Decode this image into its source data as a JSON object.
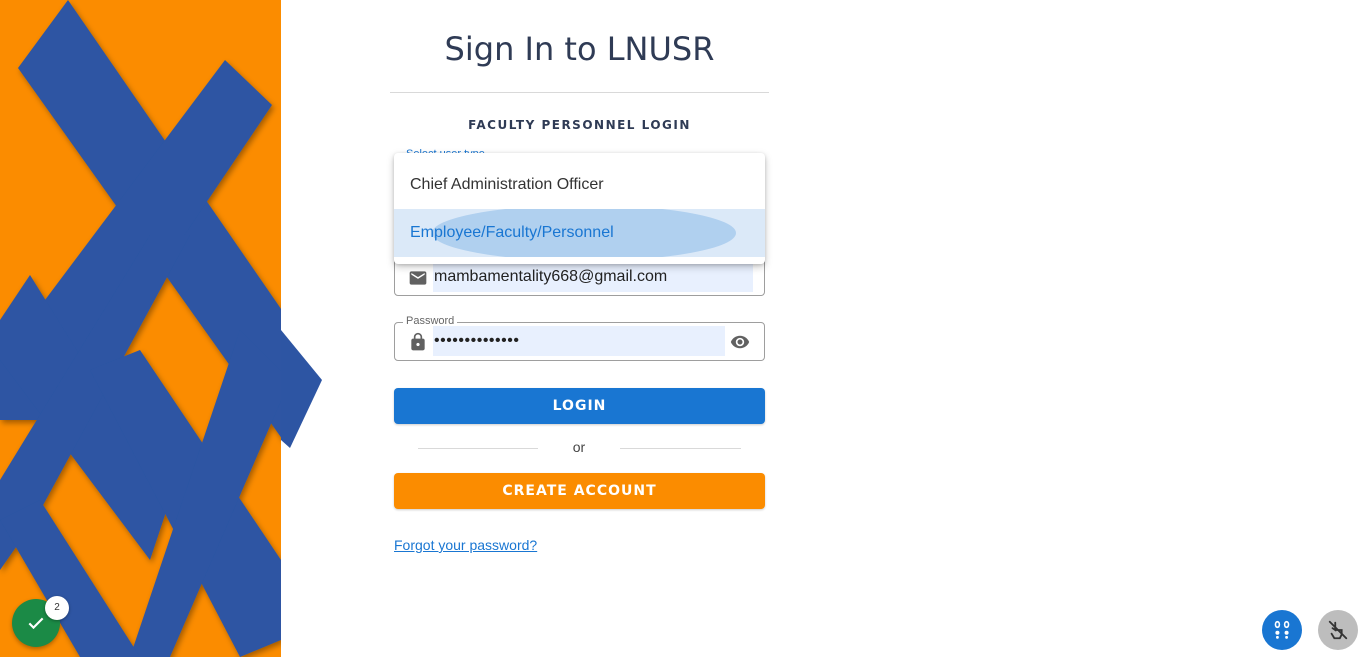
{
  "page": {
    "title": "Sign In to LNUSR",
    "subtitle": "FACULTY PERSONNEL LOGIN"
  },
  "user_type_select": {
    "label": "Select user type",
    "options": [
      {
        "label": "Chief Administration Officer",
        "highlighted": false
      },
      {
        "label": "Employee/Faculty/Personnel",
        "highlighted": true
      }
    ]
  },
  "email_field": {
    "value": "mambamentality668@gmail.com",
    "icon": "mail-icon"
  },
  "password_field": {
    "label": "Password",
    "value": "••••••••••••••",
    "icon": "lock-icon",
    "toggle_icon": "eye-icon"
  },
  "actions": {
    "login_label": "LOGIN",
    "or_label": "or",
    "create_account_label": "CREATE ACCOUNT",
    "forgot_password_label": "Forgot your password?"
  },
  "widgets": {
    "check_badge_count": "2"
  },
  "colors": {
    "primary": "#1976d2",
    "accent": "#fb8c00",
    "art_blue": "#2d55a3",
    "title": "#2f3b55",
    "success": "#1b8a46"
  }
}
